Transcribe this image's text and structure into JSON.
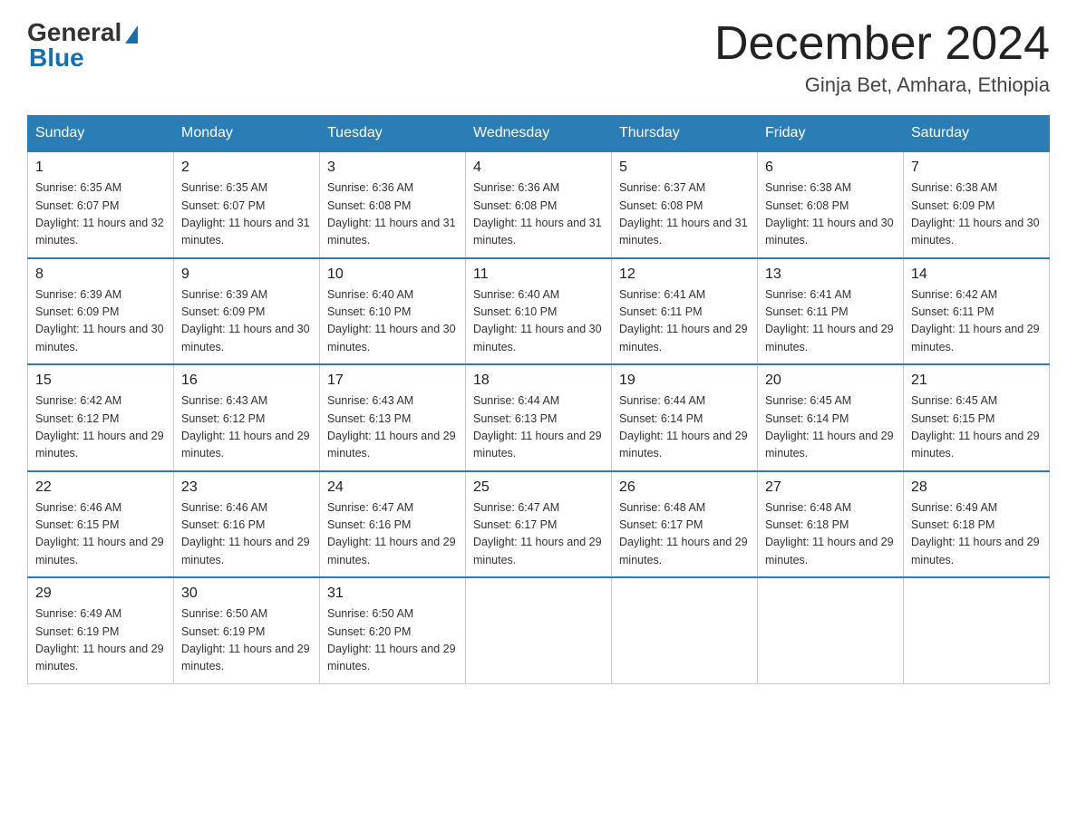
{
  "logo": {
    "general": "General",
    "blue": "Blue"
  },
  "title": {
    "month": "December 2024",
    "location": "Ginja Bet, Amhara, Ethiopia"
  },
  "weekdays": [
    "Sunday",
    "Monday",
    "Tuesday",
    "Wednesday",
    "Thursday",
    "Friday",
    "Saturday"
  ],
  "weeks": [
    [
      {
        "day": "1",
        "sunrise": "6:35 AM",
        "sunset": "6:07 PM",
        "daylight": "11 hours and 32 minutes."
      },
      {
        "day": "2",
        "sunrise": "6:35 AM",
        "sunset": "6:07 PM",
        "daylight": "11 hours and 31 minutes."
      },
      {
        "day": "3",
        "sunrise": "6:36 AM",
        "sunset": "6:08 PM",
        "daylight": "11 hours and 31 minutes."
      },
      {
        "day": "4",
        "sunrise": "6:36 AM",
        "sunset": "6:08 PM",
        "daylight": "11 hours and 31 minutes."
      },
      {
        "day": "5",
        "sunrise": "6:37 AM",
        "sunset": "6:08 PM",
        "daylight": "11 hours and 31 minutes."
      },
      {
        "day": "6",
        "sunrise": "6:38 AM",
        "sunset": "6:08 PM",
        "daylight": "11 hours and 30 minutes."
      },
      {
        "day": "7",
        "sunrise": "6:38 AM",
        "sunset": "6:09 PM",
        "daylight": "11 hours and 30 minutes."
      }
    ],
    [
      {
        "day": "8",
        "sunrise": "6:39 AM",
        "sunset": "6:09 PM",
        "daylight": "11 hours and 30 minutes."
      },
      {
        "day": "9",
        "sunrise": "6:39 AM",
        "sunset": "6:09 PM",
        "daylight": "11 hours and 30 minutes."
      },
      {
        "day": "10",
        "sunrise": "6:40 AM",
        "sunset": "6:10 PM",
        "daylight": "11 hours and 30 minutes."
      },
      {
        "day": "11",
        "sunrise": "6:40 AM",
        "sunset": "6:10 PM",
        "daylight": "11 hours and 30 minutes."
      },
      {
        "day": "12",
        "sunrise": "6:41 AM",
        "sunset": "6:11 PM",
        "daylight": "11 hours and 29 minutes."
      },
      {
        "day": "13",
        "sunrise": "6:41 AM",
        "sunset": "6:11 PM",
        "daylight": "11 hours and 29 minutes."
      },
      {
        "day": "14",
        "sunrise": "6:42 AM",
        "sunset": "6:11 PM",
        "daylight": "11 hours and 29 minutes."
      }
    ],
    [
      {
        "day": "15",
        "sunrise": "6:42 AM",
        "sunset": "6:12 PM",
        "daylight": "11 hours and 29 minutes."
      },
      {
        "day": "16",
        "sunrise": "6:43 AM",
        "sunset": "6:12 PM",
        "daylight": "11 hours and 29 minutes."
      },
      {
        "day": "17",
        "sunrise": "6:43 AM",
        "sunset": "6:13 PM",
        "daylight": "11 hours and 29 minutes."
      },
      {
        "day": "18",
        "sunrise": "6:44 AM",
        "sunset": "6:13 PM",
        "daylight": "11 hours and 29 minutes."
      },
      {
        "day": "19",
        "sunrise": "6:44 AM",
        "sunset": "6:14 PM",
        "daylight": "11 hours and 29 minutes."
      },
      {
        "day": "20",
        "sunrise": "6:45 AM",
        "sunset": "6:14 PM",
        "daylight": "11 hours and 29 minutes."
      },
      {
        "day": "21",
        "sunrise": "6:45 AM",
        "sunset": "6:15 PM",
        "daylight": "11 hours and 29 minutes."
      }
    ],
    [
      {
        "day": "22",
        "sunrise": "6:46 AM",
        "sunset": "6:15 PM",
        "daylight": "11 hours and 29 minutes."
      },
      {
        "day": "23",
        "sunrise": "6:46 AM",
        "sunset": "6:16 PM",
        "daylight": "11 hours and 29 minutes."
      },
      {
        "day": "24",
        "sunrise": "6:47 AM",
        "sunset": "6:16 PM",
        "daylight": "11 hours and 29 minutes."
      },
      {
        "day": "25",
        "sunrise": "6:47 AM",
        "sunset": "6:17 PM",
        "daylight": "11 hours and 29 minutes."
      },
      {
        "day": "26",
        "sunrise": "6:48 AM",
        "sunset": "6:17 PM",
        "daylight": "11 hours and 29 minutes."
      },
      {
        "day": "27",
        "sunrise": "6:48 AM",
        "sunset": "6:18 PM",
        "daylight": "11 hours and 29 minutes."
      },
      {
        "day": "28",
        "sunrise": "6:49 AM",
        "sunset": "6:18 PM",
        "daylight": "11 hours and 29 minutes."
      }
    ],
    [
      {
        "day": "29",
        "sunrise": "6:49 AM",
        "sunset": "6:19 PM",
        "daylight": "11 hours and 29 minutes."
      },
      {
        "day": "30",
        "sunrise": "6:50 AM",
        "sunset": "6:19 PM",
        "daylight": "11 hours and 29 minutes."
      },
      {
        "day": "31",
        "sunrise": "6:50 AM",
        "sunset": "6:20 PM",
        "daylight": "11 hours and 29 minutes."
      },
      null,
      null,
      null,
      null
    ]
  ]
}
